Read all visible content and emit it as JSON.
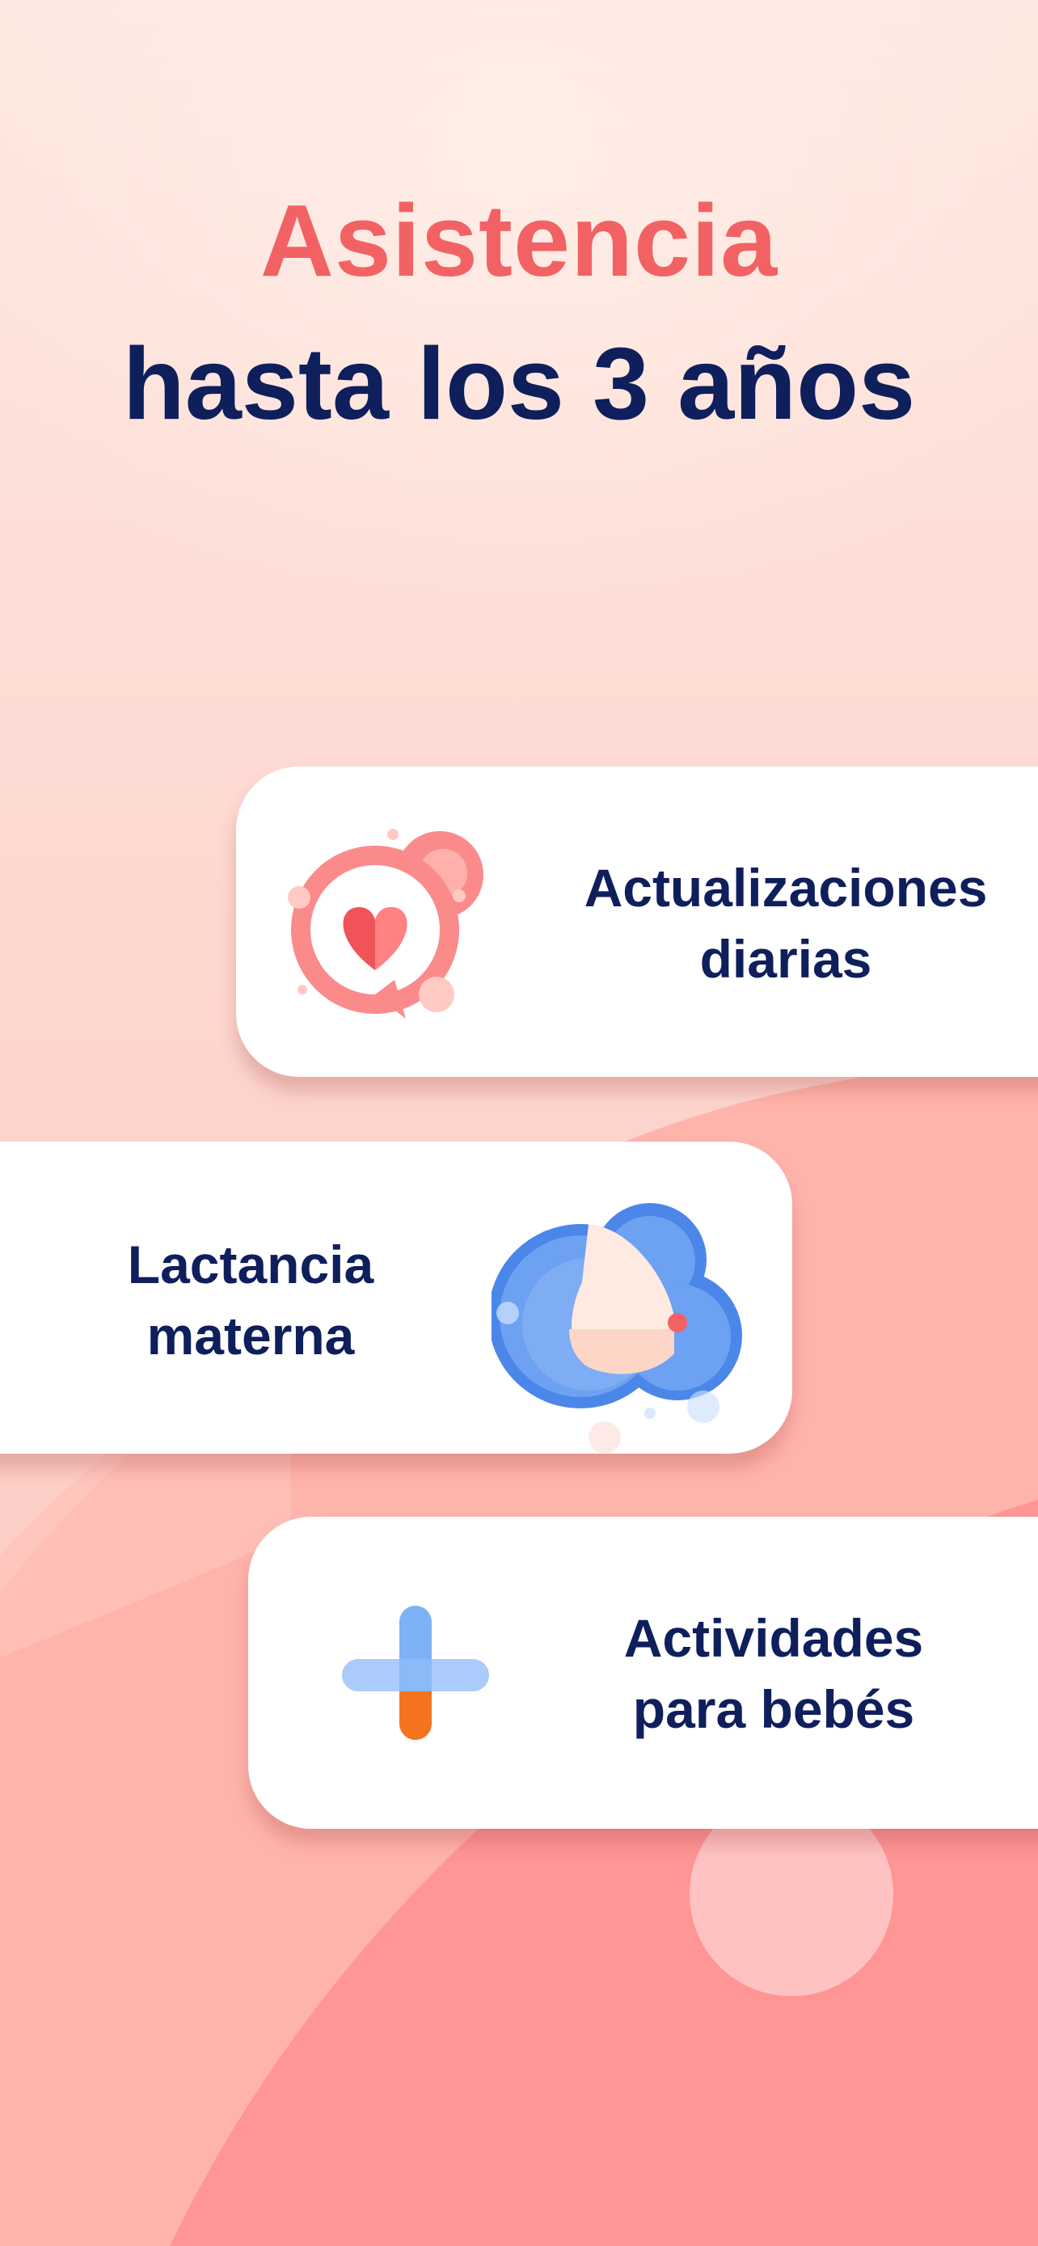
{
  "colors": {
    "accent": "#f26265",
    "navy": "#0e1f5c",
    "background_top": "#fde8e0",
    "background_wave": "#ff9595"
  },
  "headline": {
    "accent": "Asistencia",
    "main": "hasta los 3 años"
  },
  "cards": [
    {
      "icon": "heart-chat-bubble-icon",
      "line1": "Actualizaciones",
      "line2": "diarias"
    },
    {
      "icon": "breastfeeding-icon",
      "line1": "Lactancia",
      "line2": "materna"
    },
    {
      "icon": "plus-activities-icon",
      "line1": "Actividades",
      "line2": "para bebés"
    }
  ]
}
